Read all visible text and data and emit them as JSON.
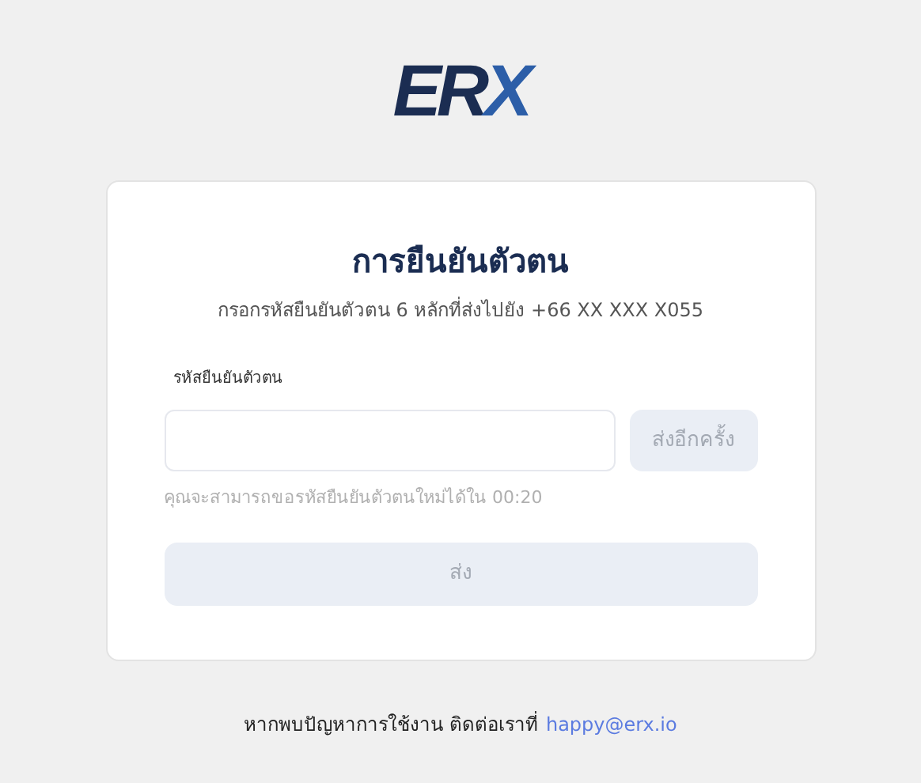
{
  "logo": {
    "main": "ER",
    "accent": "X"
  },
  "card": {
    "title": "การยืนยันตัวตน",
    "subtitle": "กรอกรหัสยืนยันตัวตน 6 หลักที่ส่งไปยัง +66 XX XXX X055",
    "field": {
      "label": "รหัสยืนยันตัวตน"
    },
    "resend_button": {
      "label": "ส่งอีกครั้ง",
      "disabled": true
    },
    "hint": "คุณจะสามารถขอรหัสยืนยันตัวตนใหม่ได้ใน 00:20",
    "submit_button": {
      "label": "ส่ง",
      "disabled": true
    }
  },
  "footer": {
    "text": "หากพบปัญหาการใช้งาน ติดต่อเราที่",
    "link": "happy@erx.io"
  }
}
